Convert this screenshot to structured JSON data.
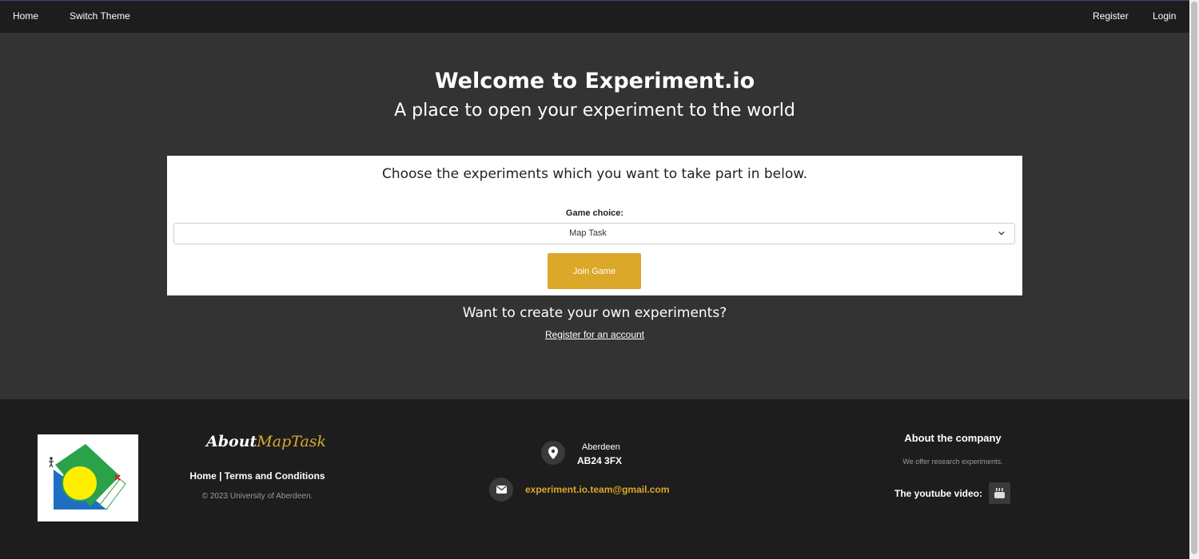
{
  "nav": {
    "home": "Home",
    "switch_theme": "Switch Theme",
    "register": "Register",
    "login": "Login"
  },
  "hero": {
    "title": "Welcome to Experiment.io",
    "subtitle": "A place to open your experiment to the world"
  },
  "card": {
    "heading": "Choose the experiments which you want to take part in below.",
    "label": "Game choice:",
    "selected": "Map Task",
    "button": "Join Game"
  },
  "cta": {
    "title": "Want to create your own experiments?",
    "link": "Register for an account"
  },
  "footer": {
    "brand_word1": "About",
    "brand_word2": "MapTask",
    "link_home": "Home",
    "separator": "|",
    "link_terms": "Terms and Conditions",
    "copyright": "© 2023 University of Aberdeen.",
    "city": "Aberdeen",
    "postcode": "AB24 3FX",
    "email": "experiment.io.team@gmail.com",
    "company_title": "About the company",
    "company_desc": "We offer research experiments.",
    "youtube_label": "The youtube video:"
  },
  "colors": {
    "accent": "#dba82a",
    "nav_bg": "#1d1d1d",
    "page_bg": "#333333"
  },
  "icons": [
    "map-marker-icon",
    "envelope-icon",
    "youtube-icon",
    "chevron-down-icon"
  ]
}
